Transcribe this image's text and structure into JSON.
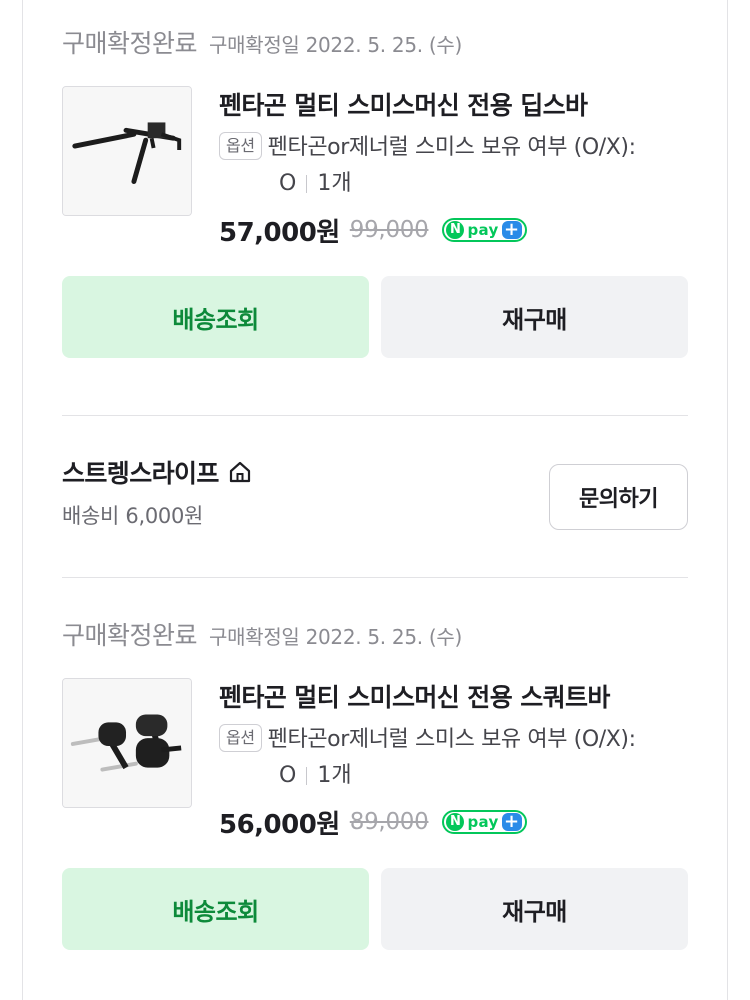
{
  "orders": [
    {
      "status": "구매확정완료",
      "date": "구매확정일 2022. 5. 25. (수)",
      "product_name": "펜타곤 멀티 스미스머신 전용 딥스바",
      "option_badge": "옵션",
      "option_text": "펜타곤or제너럴 스미스 보유 여부 (O/X):",
      "option_value": "O",
      "quantity": "1개",
      "price": "57,000원",
      "original_price": "99,000",
      "thumbnail_icon": "dip-bar-product-image",
      "track_button": "배송조회",
      "rebuy_button": "재구매"
    },
    {
      "status": "구매확정완료",
      "date": "구매확정일 2022. 5. 25. (수)",
      "product_name": "펜타곤 멀티 스미스머신 전용 스쿼트바",
      "option_badge": "옵션",
      "option_text": "펜타곤or제너럴 스미스 보유 여부 (O/X):",
      "option_value": "O",
      "quantity": "1개",
      "price": "56,000원",
      "original_price": "89,000",
      "thumbnail_icon": "squat-bar-product-image",
      "track_button": "배송조회",
      "rebuy_button": "재구매"
    }
  ],
  "npay": {
    "n": "N",
    "text": "pay",
    "plus": "+"
  },
  "seller": {
    "name": "스트렝스라이프",
    "icon": "store-home-icon",
    "shipping_fee": "배송비 6,000원",
    "inquiry_button": "문의하기"
  },
  "colors": {
    "accent_green": "#03c75a",
    "track_bg": "#d9f6e1",
    "track_text": "#0d8a3a",
    "npay_plus_blue": "#2a8be8"
  }
}
